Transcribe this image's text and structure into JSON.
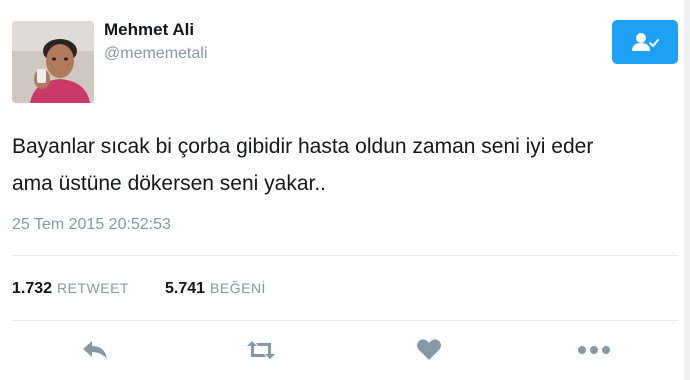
{
  "user": {
    "name": "Mehmet Ali",
    "handle": "@mememetali"
  },
  "tweet": {
    "lines": [
      "Bayanlar sıcak bi çorba gibidir hasta oldun zaman seni iyi eder",
      "ama üstüne dökersen seni yakar.."
    ],
    "timestamp": "25 Tem 2015 20:52:53"
  },
  "stats": {
    "retweets": {
      "count": "1.732",
      "label": "RETWEET"
    },
    "likes": {
      "count": "5.741",
      "label": "BEĞENİ"
    }
  },
  "actions": [
    "reply-icon",
    "retweet-icon",
    "like-icon",
    "more-icon"
  ],
  "colors": {
    "accent": "#1da1f2",
    "icon": "#8899a6",
    "muted_text": "#8899a6",
    "divider": "#e6ecf0"
  }
}
